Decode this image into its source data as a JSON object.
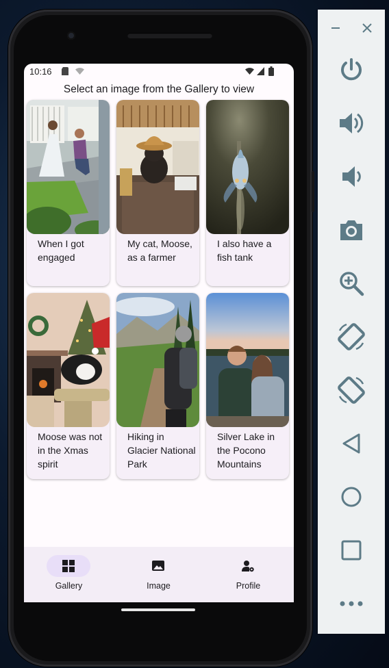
{
  "status": {
    "time": "10:16"
  },
  "header": {
    "title": "Select an image from the Gallery to view"
  },
  "gallery": [
    {
      "caption": "When I got engaged",
      "photo": "engagement-photo"
    },
    {
      "caption": "My cat, Moose, as a farmer",
      "photo": "cat-cowboy-hat-photo"
    },
    {
      "caption": "I also have a fish tank",
      "photo": "fish-tank-photo"
    },
    {
      "caption": "Moose was not in the Xmas spirit",
      "photo": "cat-santa-hat-photo"
    },
    {
      "caption": "Hiking in Glacier National Park",
      "photo": "hiking-photo"
    },
    {
      "caption": "Silver Lake in the Pocono Mountains",
      "photo": "lake-couple-photo"
    }
  ],
  "navbar": {
    "items": [
      {
        "label": "Gallery",
        "icon": "grid-icon",
        "active": true
      },
      {
        "label": "Image",
        "icon": "image-icon",
        "active": false
      },
      {
        "label": "Profile",
        "icon": "person-settings-icon",
        "active": false
      }
    ]
  },
  "emulator_controls": [
    "minimize",
    "close",
    "power",
    "volume-up",
    "volume-down",
    "camera",
    "zoom",
    "rotate-left",
    "rotate-right",
    "back",
    "home",
    "overview",
    "more"
  ],
  "colors": {
    "nav_active_pill": "#e8def8",
    "card_bg": "#f6eff8",
    "navbar_bg": "#f3edf6",
    "emulator_icon": "#5d7b87"
  }
}
